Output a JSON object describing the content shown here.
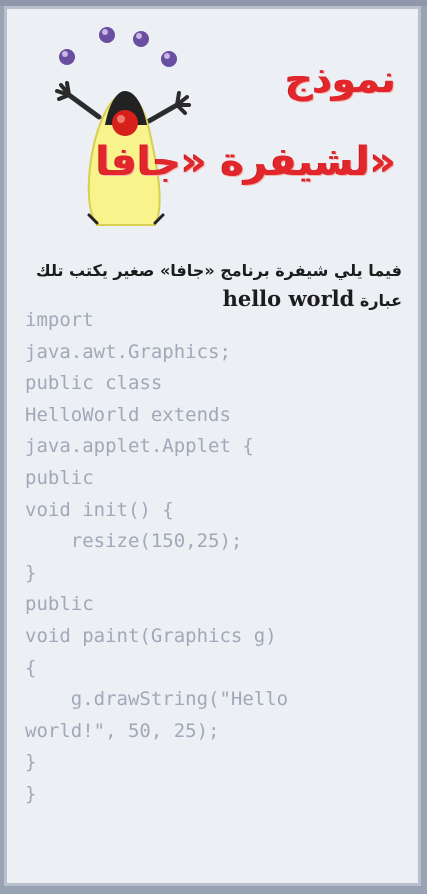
{
  "title": {
    "line1": "نموذج",
    "line2": "لشيفرة «جافا»"
  },
  "intro": {
    "text": "فيما يلي شيفرة برنامج «جافا» صغير يكتب تلك عبارة",
    "highlight": "hello world"
  },
  "code": {
    "lines": [
      "import",
      "java.awt.Graphics;",
      "public class",
      "HelloWorld extends",
      "java.applet.Applet {",
      "public",
      "void init() {",
      "    resize(150,25);",
      "}",
      "public",
      "void paint(Graphics g)",
      "{",
      "    g.drawString(\"Hello",
      "world!\", 50, 25);",
      "}",
      "}"
    ]
  },
  "colors": {
    "title": "#e1272b",
    "code": "#a1a9b8",
    "background": "#eceff4",
    "border": "#9aa3b4"
  }
}
